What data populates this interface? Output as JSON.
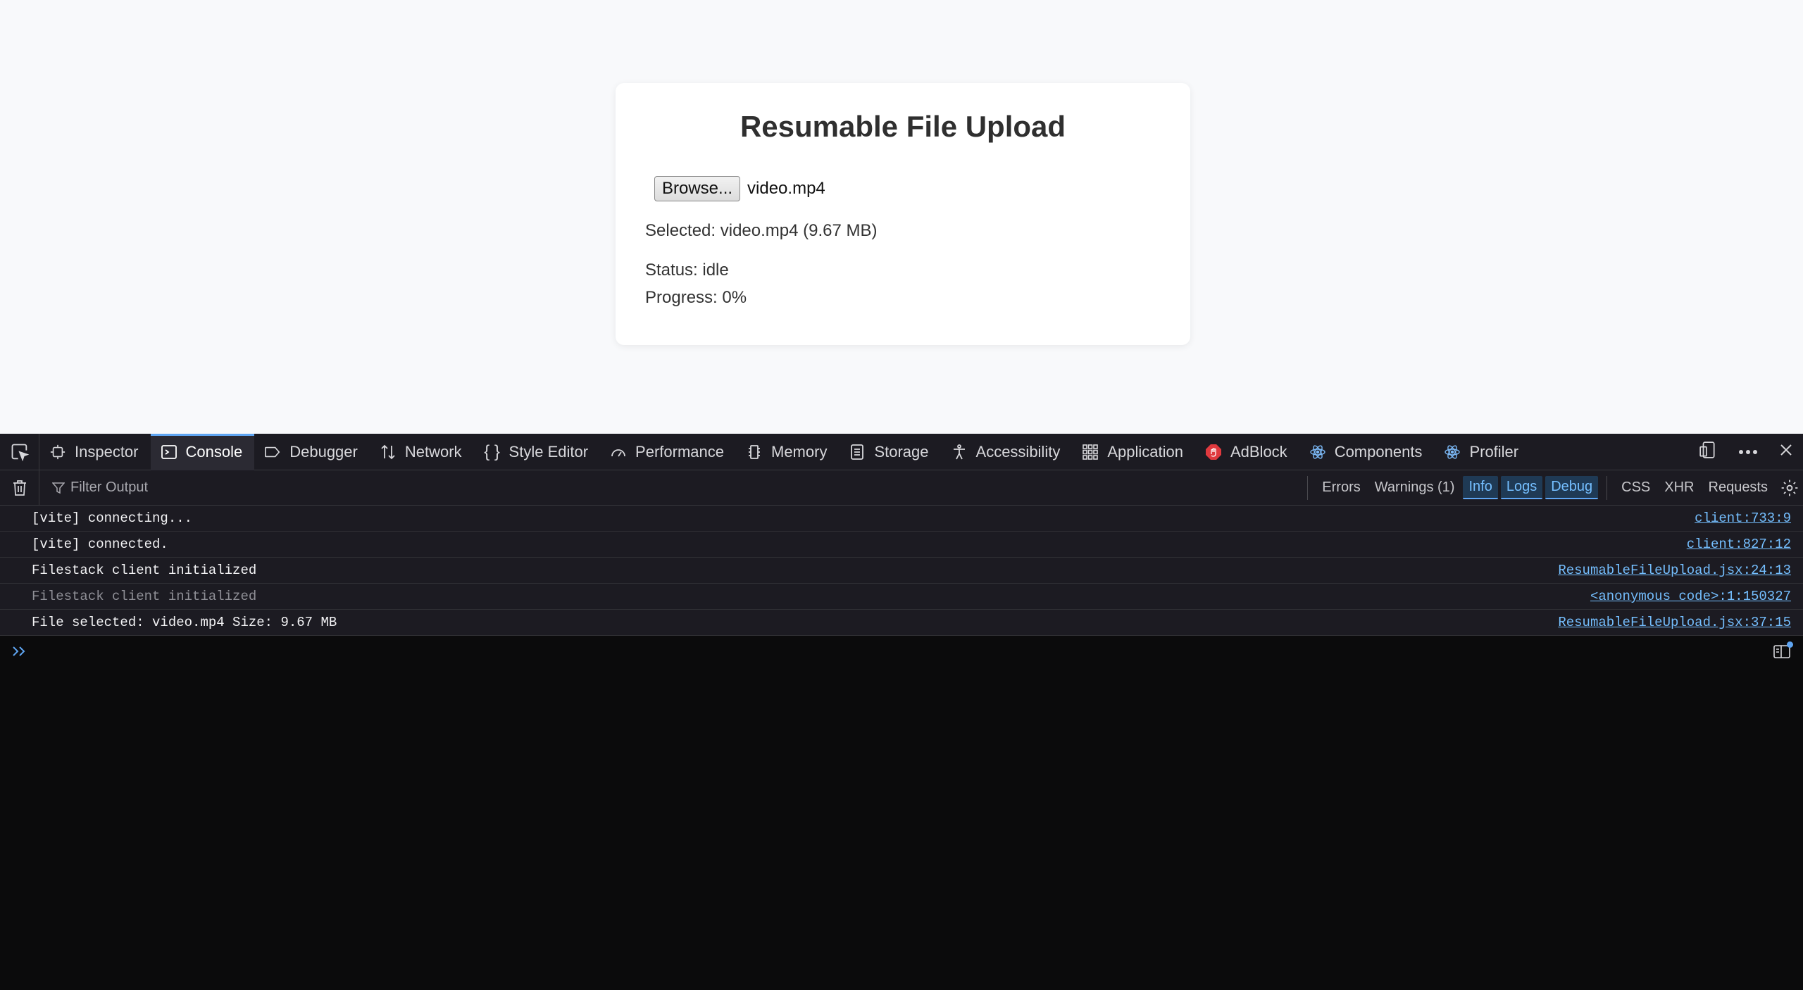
{
  "page": {
    "title": "Resumable File Upload",
    "browse_label": "Browse...",
    "file_name": "video.mp4",
    "selected": "Selected: video.mp4 (9.67 MB)",
    "status": "Status: idle",
    "progress": "Progress: 0%"
  },
  "devtools": {
    "tabs": [
      {
        "label": "Inspector",
        "icon": "inspector-icon"
      },
      {
        "label": "Console",
        "icon": "console-icon",
        "active": true
      },
      {
        "label": "Debugger",
        "icon": "debugger-icon"
      },
      {
        "label": "Network",
        "icon": "network-icon"
      },
      {
        "label": "Style Editor",
        "icon": "style-editor-icon"
      },
      {
        "label": "Performance",
        "icon": "performance-icon"
      },
      {
        "label": "Memory",
        "icon": "memory-icon"
      },
      {
        "label": "Storage",
        "icon": "storage-icon"
      },
      {
        "label": "Accessibility",
        "icon": "accessibility-icon"
      },
      {
        "label": "Application",
        "icon": "application-icon"
      },
      {
        "label": "AdBlock",
        "icon": "adblock-icon"
      },
      {
        "label": "Components",
        "icon": "react-icon"
      },
      {
        "label": "Profiler",
        "icon": "react-icon"
      }
    ],
    "filter_placeholder": "Filter Output",
    "filters": {
      "errors": "Errors",
      "warnings": "Warnings (1)",
      "info": "Info",
      "logs": "Logs",
      "debug": "Debug",
      "css": "CSS",
      "xhr": "XHR",
      "requests": "Requests"
    },
    "console_rows": [
      {
        "message": "[vite] connecting...",
        "source": "client:733:9"
      },
      {
        "message": "[vite] connected.",
        "source": "client:827:12"
      },
      {
        "message": "Filestack client initialized",
        "source": "ResumableFileUpload.jsx:24:13"
      },
      {
        "message": "Filestack client initialized",
        "source": "<anonymous code>:1:150327",
        "dim": true
      },
      {
        "message": "File selected: video.mp4 Size: 9.67 MB",
        "source": "ResumableFileUpload.jsx:37:15"
      }
    ],
    "colors": {
      "accent": "#5fa5f2",
      "link": "#75bfff",
      "panel": "#1c1b22"
    }
  }
}
